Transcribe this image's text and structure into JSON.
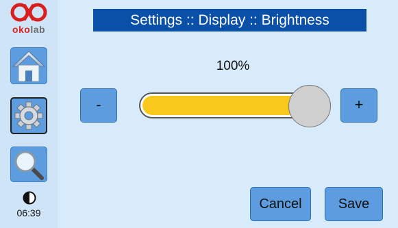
{
  "logo": {
    "brand_prefix": "oko",
    "brand_suffix": "lab"
  },
  "sidebar": {
    "items": [
      {
        "icon": "home-icon"
      },
      {
        "icon": "gear-icon",
        "active": true
      },
      {
        "icon": "search-icon"
      }
    ],
    "contrast_icon": "contrast-icon",
    "clock": "06:39"
  },
  "header": {
    "title": "Settings :: Display :: Brightness"
  },
  "brightness": {
    "value_label": "100%",
    "level": 1.0,
    "minus_label": "-",
    "plus_label": "+"
  },
  "actions": {
    "cancel_label": "Cancel",
    "save_label": "Save"
  },
  "colors": {
    "accent": "#5d9cde",
    "title_bg": "#0a4fa8",
    "slider_fill": "#f8c81c",
    "background": "#d8ebfb"
  }
}
